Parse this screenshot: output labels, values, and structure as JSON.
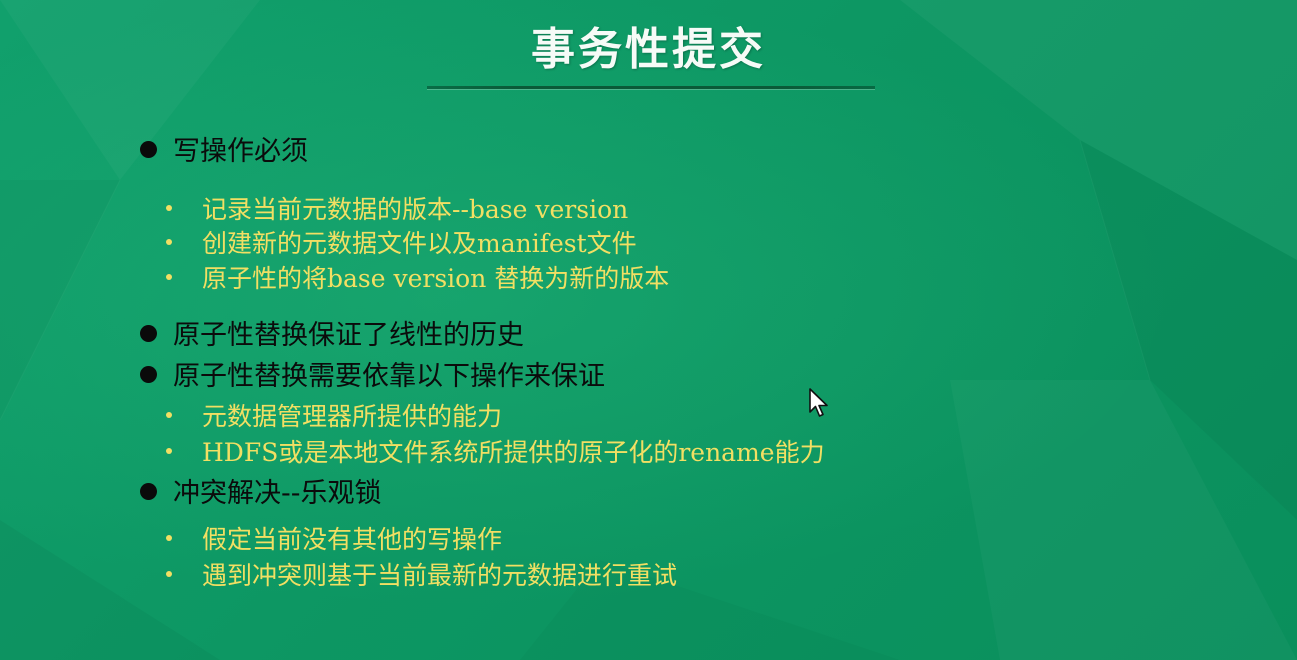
{
  "slide": {
    "title": "事务性提交",
    "items": [
      {
        "text": "写操作必须",
        "subitems": [
          "记录当前元数据的版本--base version",
          "创建新的元数据文件以及manifest文件",
          "原子性的将base version 替换为新的版本"
        ]
      },
      {
        "text": "原子性替换保证了线性的历史",
        "subitems": []
      },
      {
        "text": "原子性替换需要依靠以下操作来保证",
        "subitems": [
          "元数据管理器所提供的能力",
          "HDFS或是本地文件系统所提供的原子化的rename能力"
        ]
      },
      {
        "text": "冲突解决--乐观锁",
        "subitems": [
          "假定当前没有其他的写操作",
          "遇到冲突则基于当前最新的元数据进行重试"
        ]
      }
    ]
  },
  "colors": {
    "background": "#0f9a68",
    "title": "#f6fbf7",
    "bullet_text": "#0b0b0b",
    "sub_bullet_text": "#f2df63"
  },
  "icons": [
    "bullet-dot-icon",
    "sub-bullet-dot-icon",
    "mouse-cursor-icon"
  ]
}
